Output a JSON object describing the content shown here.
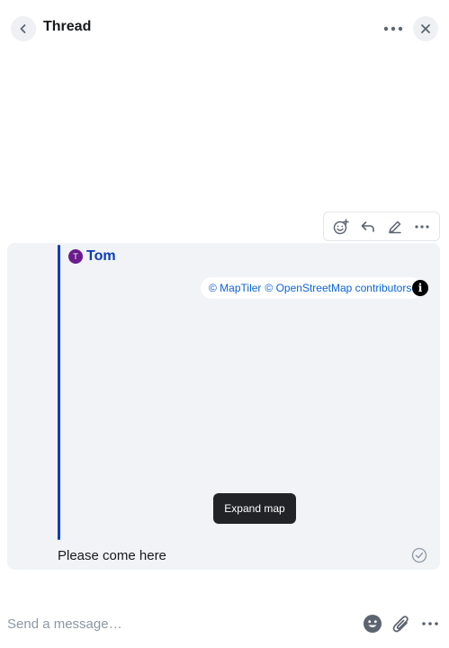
{
  "header": {
    "title": "Thread",
    "back_icon": "chevron-left-icon",
    "options_icon": "more-horizontal-icon",
    "close_icon": "close-icon"
  },
  "message_toolbar": {
    "icons": [
      "react-icon",
      "reply-icon",
      "edit-icon",
      "more-horizontal-icon"
    ]
  },
  "message": {
    "sender": "Tom",
    "avatar_initial": "T",
    "avatar_color": "#6a1b8c",
    "map": {
      "attribution_maptiler": "© MapTiler",
      "attribution_osm": "© OpenStreetMap contributors",
      "info_label": "i",
      "tooltip": "Expand map"
    },
    "body": "Please come here",
    "status_icon": "read-receipt-icon"
  },
  "composer": {
    "placeholder": "Send a message…",
    "icons": [
      "emoji-icon",
      "attachment-icon",
      "more-horizontal-icon"
    ]
  },
  "colors": {
    "accent": "#0b3db5",
    "message_bg": "#f1f3f6",
    "link": "#0b63d8"
  }
}
